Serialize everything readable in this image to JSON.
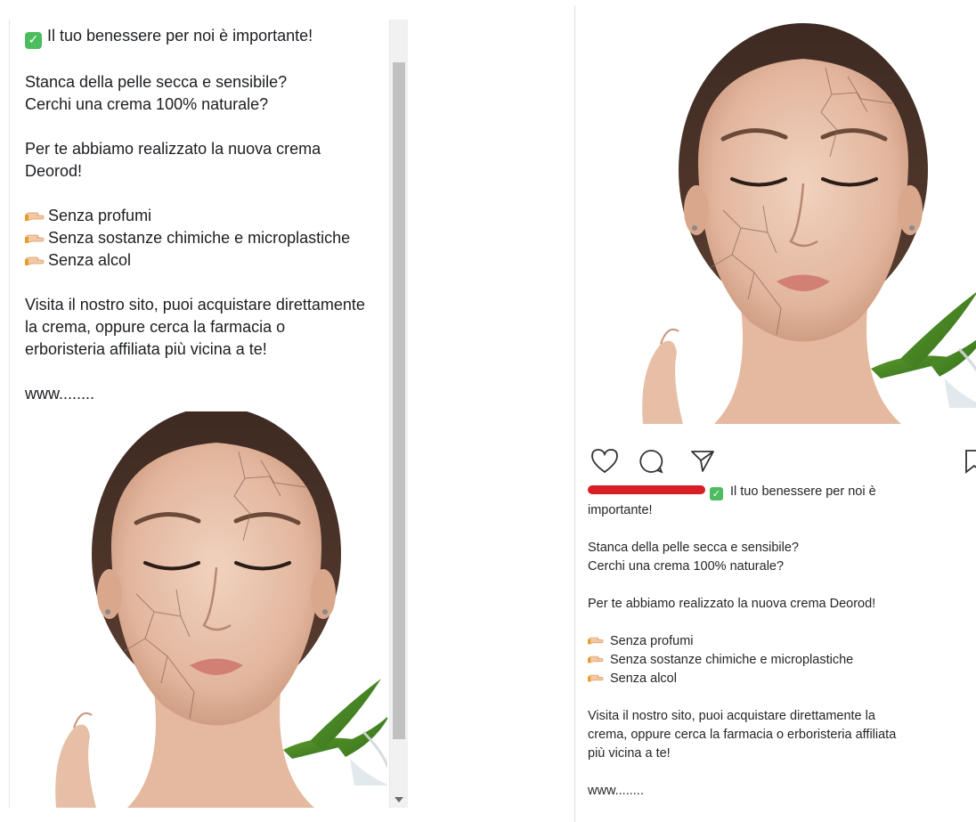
{
  "left_post": {
    "headline": "Il tuo benessere per noi è importante!",
    "question_1": "Stanca della pelle secca e sensibile?",
    "question_2": "Cerchi una crema 100% naturale?",
    "intro_1": "Per te abbiamo realizzato la nuova crema",
    "intro_2": "Deorod!",
    "bullets": [
      "Senza profumi",
      "Senza sostanze chimiche e microplastiche",
      "Senza alcol"
    ],
    "visit_1": "Visita il nostro sito, puoi acquistare direttamente",
    "visit_2": "la crema, oppure cerca la farmacia o",
    "visit_3": "erboristeria affiliata più vicina a te!",
    "link": "www........",
    "image_alt": "Donna con pelle screpolata e pianta di aloe"
  },
  "right_post": {
    "headline_1": "Il tuo benessere per noi è",
    "headline_2": "importante!",
    "question_1": "Stanca della pelle secca e sensibile?",
    "question_2": "Cerchi una crema 100% naturale?",
    "intro": "Per te abbiamo realizzato la nuova crema Deorod!",
    "bullets": [
      "Senza profumi",
      "Senza sostanze chimiche e microplastiche",
      "Senza alcol"
    ],
    "visit_1": "Visita il nostro sito, puoi acquistare direttamente la",
    "visit_2": "crema, oppure cerca la farmacia o erboristeria affiliata",
    "visit_3": "più vicina a te!",
    "link": "www........",
    "actions": [
      "heart-icon",
      "comment-icon",
      "share-icon",
      "bookmark-icon"
    ]
  },
  "colors": {
    "check_green": "#4cbd5f",
    "redaction_red": "#d91f26",
    "skin": "#e7bfa6"
  }
}
